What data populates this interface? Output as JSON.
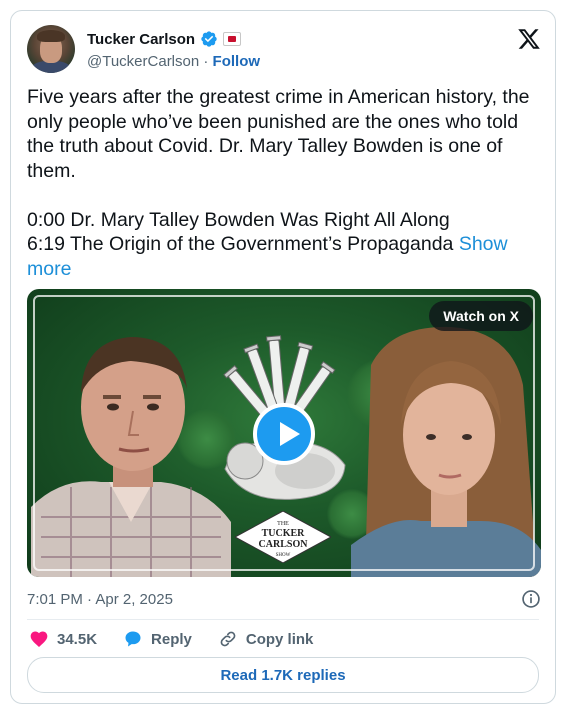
{
  "author": {
    "name": "Tucker Carlson",
    "handle": "@TuckerCarlson",
    "separator": " · ",
    "follow_label": "Follow"
  },
  "tweet": {
    "text": "Five years after the greatest crime in American history, the only people who’ve been punished are the ones who told the truth about Covid. Dr. Mary Talley Bowden is one of them.\n\n0:00 Dr. Mary Talley Bowden Was Right All Along\n6:19 The Origin of the Government’s Propaganda ",
    "show_more": "Show more"
  },
  "media": {
    "watch_label": "Watch on X",
    "badge_lines": [
      "THE",
      "TUCKER",
      "CARLSON",
      "SHOW"
    ]
  },
  "timestamp": "7:01 PM · Apr 2, 2025",
  "actions": {
    "likes": "34.5K",
    "reply_label": "Reply",
    "copy_link_label": "Copy link"
  },
  "read_replies_label": "Read 1.7K replies",
  "colors": {
    "link": "#1d9bf0",
    "follow": "#1d69b8",
    "like": "#f91880",
    "verified": "#1d9bf0"
  }
}
